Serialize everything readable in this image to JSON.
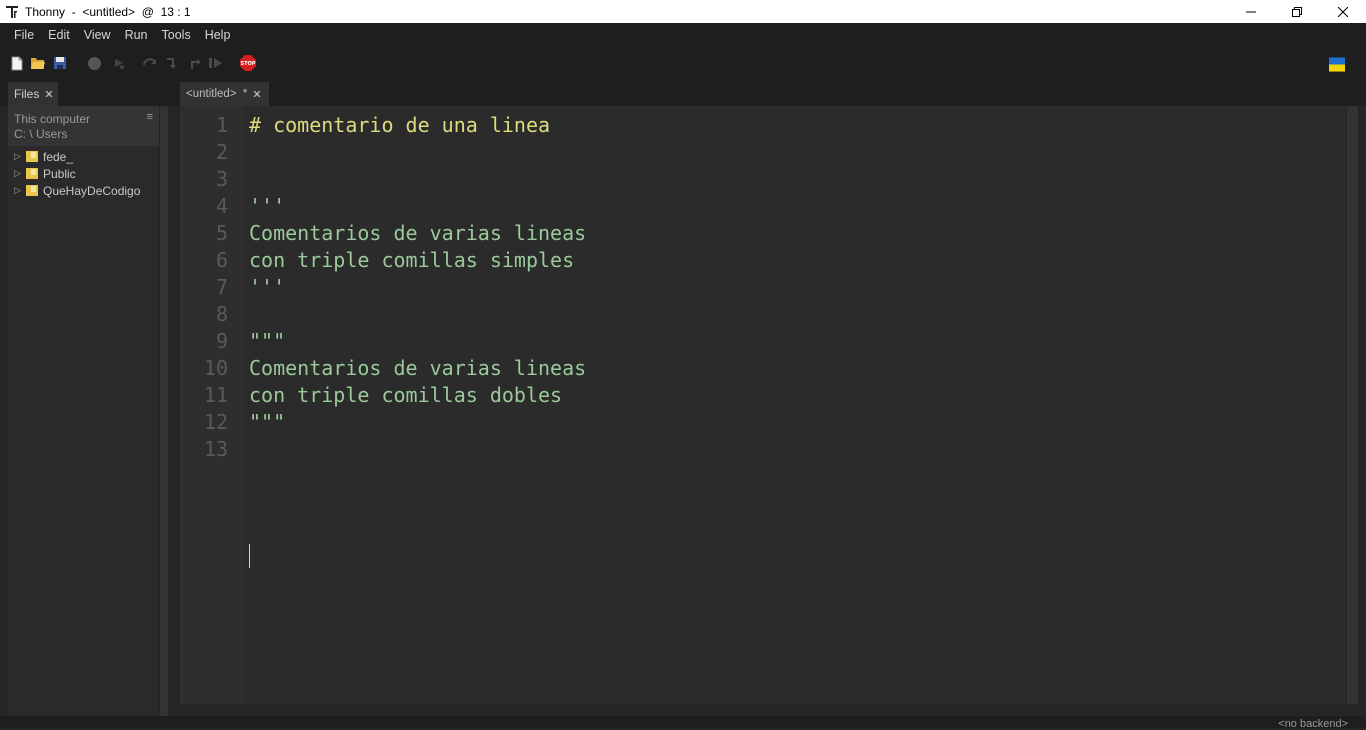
{
  "window": {
    "title": "Thonny  -  <untitled>  @  13 : 1"
  },
  "menu": [
    "File",
    "Edit",
    "View",
    "Run",
    "Tools",
    "Help"
  ],
  "toolbar": {
    "buttons": [
      "new-file",
      "open-file",
      "save-file",
      "run",
      "debug",
      "step-over",
      "step-into",
      "step-out",
      "resume",
      "stop"
    ],
    "stop_label": "STOP"
  },
  "files": {
    "tab_label": "Files",
    "location_line1": "This computer",
    "location_line2": "C: \\ Users",
    "items": [
      "fede_",
      "Public",
      "QueHayDeCodigo"
    ]
  },
  "editor": {
    "tab_label": "<untitled>  *",
    "lines": [
      {
        "num": "1",
        "text": "# comentario de una linea",
        "kind": "comment"
      },
      {
        "num": "2",
        "text": "",
        "kind": "plain"
      },
      {
        "num": "3",
        "text": "",
        "kind": "plain"
      },
      {
        "num": "4",
        "text": "'''",
        "kind": "string"
      },
      {
        "num": "5",
        "text": "Comentarios de varias lineas",
        "kind": "string"
      },
      {
        "num": "6",
        "text": "con triple comillas simples",
        "kind": "string"
      },
      {
        "num": "7",
        "text": "'''",
        "kind": "string"
      },
      {
        "num": "8",
        "text": "",
        "kind": "plain"
      },
      {
        "num": "9",
        "text": "\"\"\"",
        "kind": "string"
      },
      {
        "num": "10",
        "text": "Comentarios de varias lineas",
        "kind": "string"
      },
      {
        "num": "11",
        "text": "con triple comillas dobles",
        "kind": "string"
      },
      {
        "num": "12",
        "text": "\"\"\"",
        "kind": "string"
      },
      {
        "num": "13",
        "text": "",
        "kind": "plain"
      }
    ]
  },
  "status": {
    "backend": "<no backend>"
  },
  "colors": {
    "comment": "#dcdc7e",
    "string": "#9ac99a",
    "line_number": "#5a5a5a"
  }
}
